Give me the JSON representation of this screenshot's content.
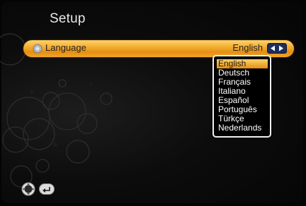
{
  "screen": {
    "title": "Setup"
  },
  "language_row": {
    "label": "Language",
    "value": "English",
    "bullet_icon": "gear-bullet-icon",
    "selector_icon": "left-right-arrows-icon"
  },
  "dropdown": {
    "selected_index": 0,
    "options": [
      "English",
      "Deutsch",
      "Français",
      "Italiano",
      "Español",
      "Português",
      "Türkçe",
      "Nederlands"
    ]
  },
  "bottom_hints": {
    "ok_icon": "ok-button-icon",
    "back_icon": "return-arrow-icon"
  },
  "colors": {
    "highlight": "#f6b23a",
    "background": "#050505",
    "text": "#ffffff"
  }
}
